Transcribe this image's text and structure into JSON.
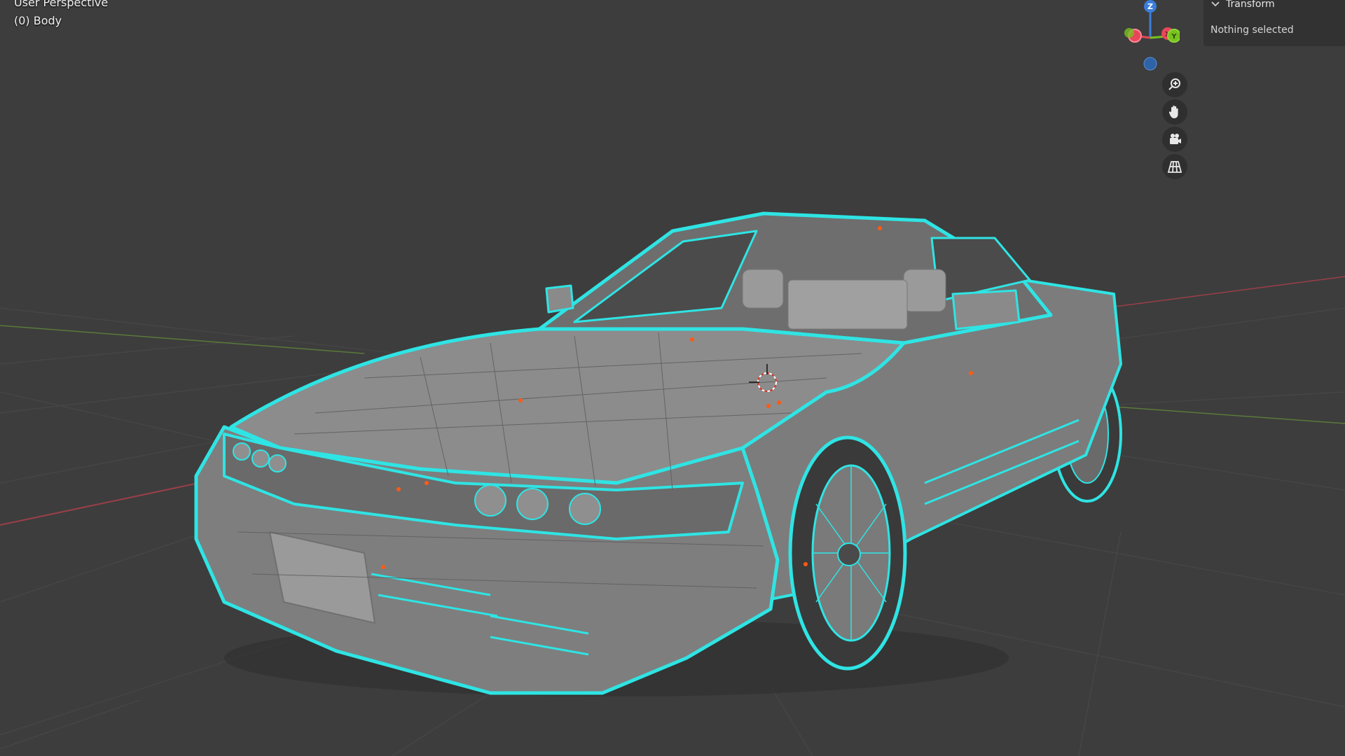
{
  "viewport": {
    "view_name": "User Perspective",
    "active_object": "(0) Body",
    "background": "#3d3d3d",
    "wire_color": "#2fe4e4",
    "vertex_color": "#ff5a14"
  },
  "gizmo": {
    "z_label": "Z",
    "x_label": "X",
    "y_label": "Y",
    "x_color": "#e8475a",
    "y_color": "#77c21f",
    "z_color": "#3b7ed9"
  },
  "nav_buttons": [
    {
      "icon": "zoom-icon"
    },
    {
      "icon": "pan-hand-icon"
    },
    {
      "icon": "camera-icon"
    },
    {
      "icon": "grid-icon"
    }
  ],
  "sidebar": {
    "panel_title": "Transform",
    "panel_body": "Nothing selected"
  }
}
